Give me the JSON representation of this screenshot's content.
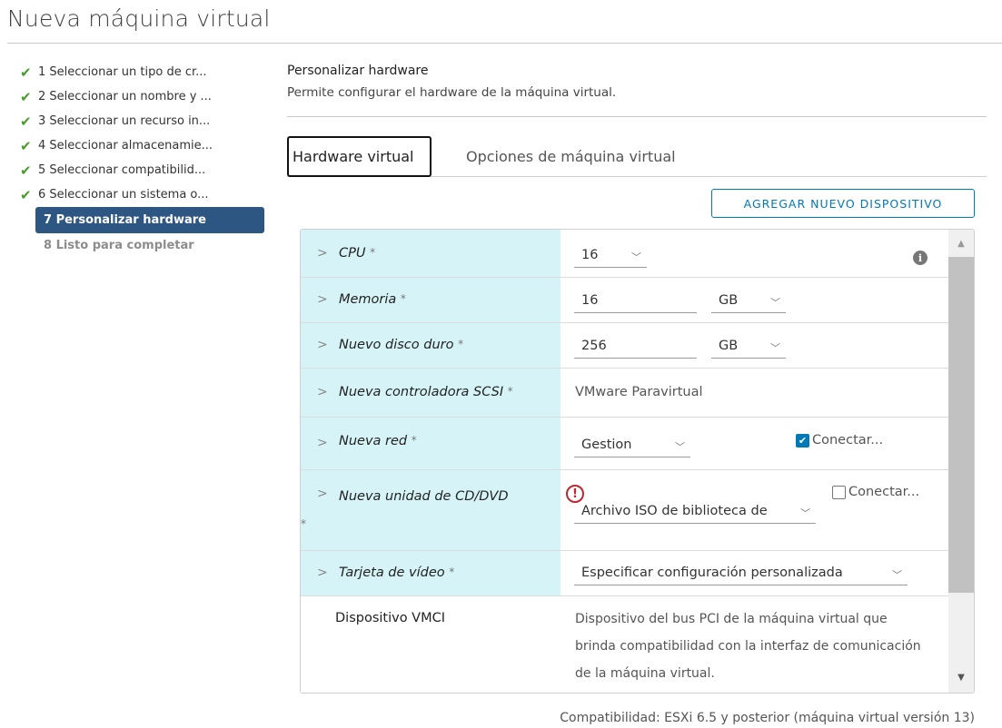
{
  "page": {
    "title": "Nueva máquina virtual"
  },
  "steps": [
    {
      "label": "1 Seleccionar un tipo de cr...",
      "state": "done"
    },
    {
      "label": "2 Seleccionar un nombre y ...",
      "state": "done"
    },
    {
      "label": "3 Seleccionar un recurso in...",
      "state": "done"
    },
    {
      "label": "4 Seleccionar almacenamie...",
      "state": "done"
    },
    {
      "label": "5 Seleccionar compatibilid...",
      "state": "done"
    },
    {
      "label": "6 Seleccionar un sistema o...",
      "state": "done"
    },
    {
      "label": "7 Personalizar hardware",
      "state": "active"
    },
    {
      "label": "8 Listo para completar",
      "state": "pending"
    }
  ],
  "pane": {
    "title": "Personalizar hardware",
    "subtitle": "Permite configurar el hardware de la máquina virtual.",
    "tabs": [
      "Hardware virtual",
      "Opciones de máquina virtual"
    ],
    "add_button": "AGREGAR NUEVO DISPOSITIVO"
  },
  "hardware": {
    "cpu": {
      "label": "CPU",
      "required": "*",
      "value": "16"
    },
    "memory": {
      "label": "Memoria",
      "required": "*",
      "value": "16",
      "unit": "GB"
    },
    "disk": {
      "label": "Nuevo disco duro",
      "required": "*",
      "value": "256",
      "unit": "GB"
    },
    "scsi": {
      "label": "Nueva controladora SCSI",
      "required": "*",
      "value": "VMware Paravirtual"
    },
    "network": {
      "label": "Nueva red",
      "required": "*",
      "value": "Gestion",
      "connect_label": "Conectar...",
      "connected": true
    },
    "cdvd": {
      "label": "Nueva unidad de CD/DVD",
      "required": "*",
      "value": "Archivo ISO de biblioteca de",
      "connect_label": "Conectar...",
      "connected": false,
      "warning": "!"
    },
    "video": {
      "label": "Tarjeta de vídeo",
      "required": "*",
      "value": "Especificar configuración personalizada"
    },
    "vmci": {
      "label": "Dispositivo VMCI",
      "description": "Dispositivo del bus PCI de la máquina virtual que brinda compatibilidad con la interfaz de comunicación de la máquina virtual."
    }
  },
  "footer": {
    "compatibility": "Compatibilidad: ESXi 6.5 y posterior (máquina virtual versión 13)"
  },
  "icons": {
    "check": "checkmark-icon",
    "chevron": "chevron-right-icon",
    "caret": "chevron-down-icon",
    "info": "info-icon",
    "warning": "warning-icon"
  },
  "colors": {
    "accent": "#0079b8",
    "active_step": "#2d5782",
    "check_green": "#4a9b2f",
    "label_bg": "#d6f4f7",
    "warning": "#c0262e"
  }
}
